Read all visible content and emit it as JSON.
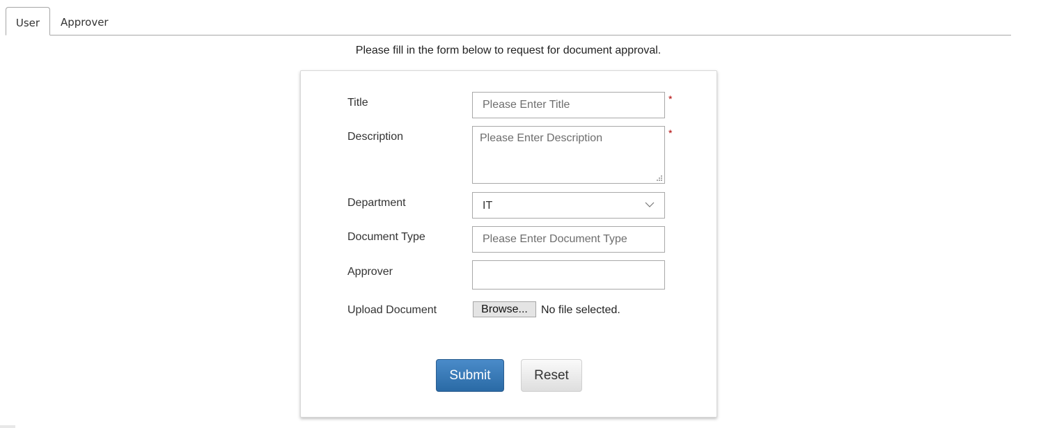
{
  "tabs": [
    {
      "label": "User",
      "active": true
    },
    {
      "label": "Approver",
      "active": false
    }
  ],
  "intro_text": "Please fill in the form below to request for document approval.",
  "form": {
    "title": {
      "label": "Title",
      "placeholder": "Please Enter Title",
      "value": "",
      "required_mark": "*"
    },
    "description": {
      "label": "Description",
      "placeholder": "Please Enter Description",
      "value": "",
      "required_mark": "*"
    },
    "department": {
      "label": "Department",
      "selected": "IT"
    },
    "document_type": {
      "label": "Document Type",
      "placeholder": "Please Enter Document Type",
      "value": ""
    },
    "approver": {
      "label": "Approver",
      "value": ""
    },
    "upload": {
      "label": "Upload Document",
      "browse_label": "Browse...",
      "status": "No file selected."
    }
  },
  "buttons": {
    "submit": "Submit",
    "reset": "Reset"
  },
  "colors": {
    "primary": "#2f72b0",
    "required": "#b00000"
  }
}
